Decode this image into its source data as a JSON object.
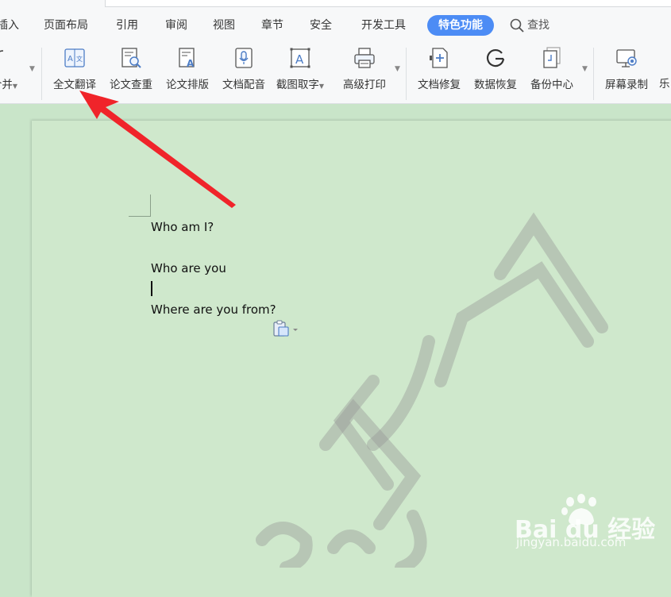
{
  "menu": {
    "items": [
      "插入",
      "页面布局",
      "引用",
      "审阅",
      "视图",
      "章节",
      "安全",
      "开发工具"
    ],
    "active": "特色功能",
    "search": "查找"
  },
  "toolbar": {
    "partial_left": "合并",
    "tools": [
      {
        "label": "全文翻译",
        "icon": "translate-icon"
      },
      {
        "label": "论文查重",
        "icon": "plagiarism-check-icon"
      },
      {
        "label": "论文排版",
        "icon": "paper-format-icon"
      },
      {
        "label": "文档配音",
        "icon": "dubbing-microphone-icon"
      },
      {
        "label": "截图取字",
        "icon": "screenshot-ocr-icon"
      },
      {
        "label": "高级打印",
        "icon": "printer-icon"
      },
      {
        "label": "文档修复",
        "icon": "doc-repair-icon"
      },
      {
        "label": "数据恢复",
        "icon": "data-recovery-icon"
      },
      {
        "label": "备份中心",
        "icon": "backup-center-icon"
      },
      {
        "label": "屏幕录制",
        "icon": "screen-record-icon"
      }
    ],
    "partial_right": "乐"
  },
  "document": {
    "lines": [
      "Who am I?",
      "Who are you",
      "Where are you from?"
    ]
  },
  "watermark": {
    "baidu_logo": "Bai du 经验",
    "baidu_url": "jingyan.baidu.com"
  },
  "colors": {
    "accent": "#4c8cf5",
    "page": "#cfe8cc",
    "arrow": "#f0242a"
  }
}
